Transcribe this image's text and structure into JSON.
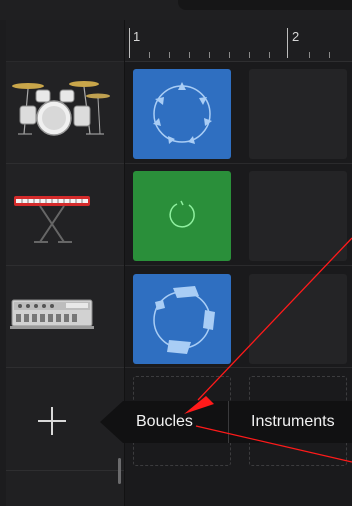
{
  "ruler": {
    "bar1": "1",
    "bar2": "2"
  },
  "tracks": [
    {
      "name": "drum-kit",
      "icon": "drum-kit-icon"
    },
    {
      "name": "keyboard",
      "icon": "keyboard-synth-icon"
    },
    {
      "name": "drum-machine",
      "icon": "drum-machine-icon"
    }
  ],
  "add_track": {
    "icon": "plus-icon"
  },
  "popup": {
    "items": [
      "Boucles",
      "Instruments"
    ]
  },
  "colors": {
    "loop_blue": "#2f6fc1",
    "loop_green": "#2a8f3a",
    "annotation_red": "#ff1a1a",
    "background": "#1c1c1e"
  }
}
